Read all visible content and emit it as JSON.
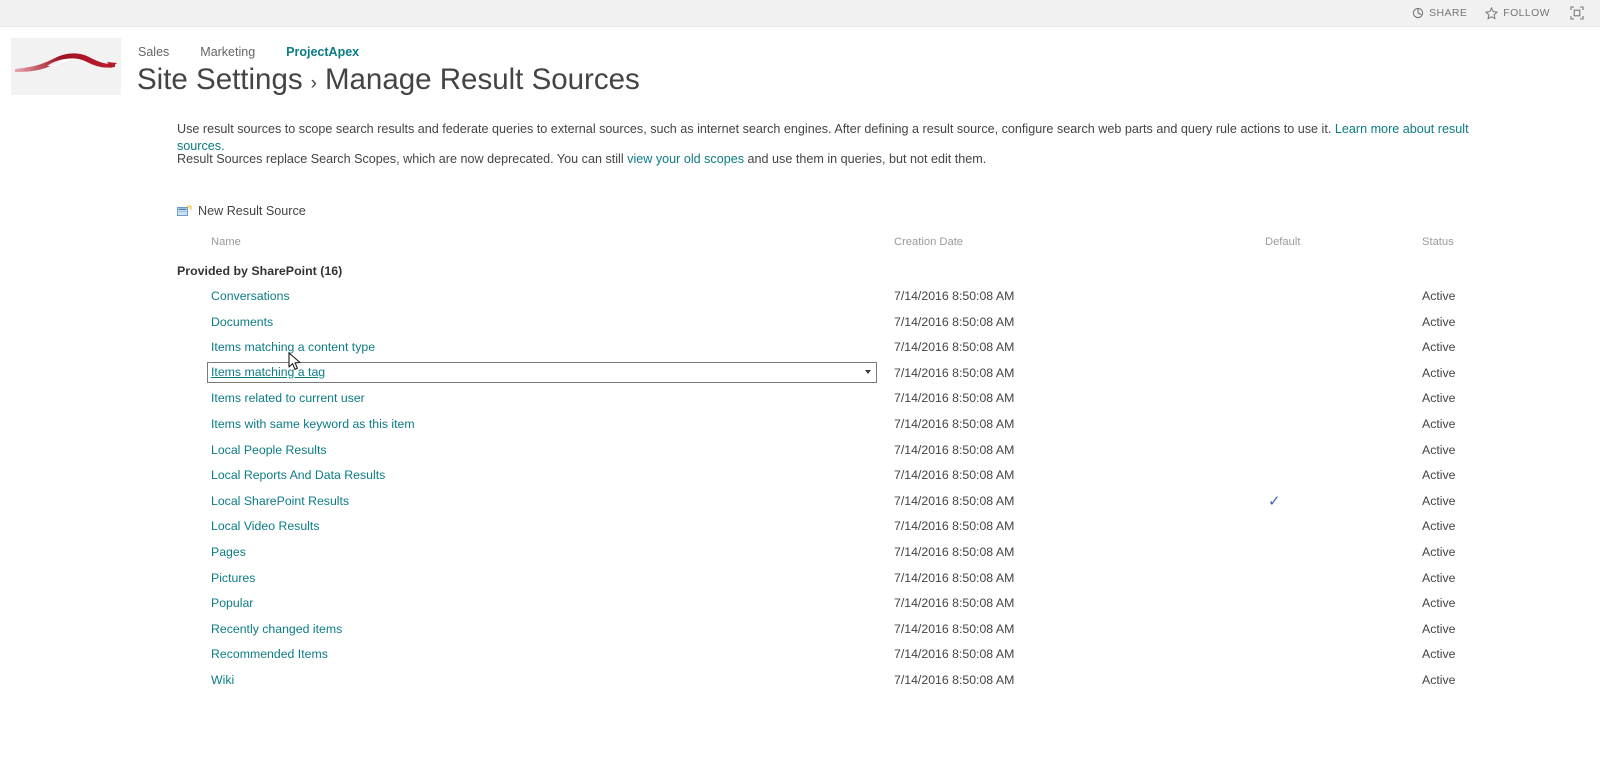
{
  "suitebar": {
    "share_label": "SHARE",
    "follow_label": "FOLLOW",
    "share_icon": "share-icon",
    "follow_icon": "star-icon",
    "focus_icon": "focus-on-content-icon"
  },
  "header": {
    "logo_alt": "car-logo",
    "nav": [
      {
        "label": "Sales",
        "current": false
      },
      {
        "label": "Marketing",
        "current": false
      },
      {
        "label": "ProjectApex",
        "current": true
      }
    ],
    "site_title": "Site Settings",
    "separator": "›",
    "page_title": "Manage Result Sources"
  },
  "description": {
    "line1_part1": "Use result sources to scope search results and federate queries to external sources, such as internet search engines. After defining a result source, configure search web parts and query rule actions to use it. ",
    "line1_link": "Learn more about result sources.",
    "line2_part1": "Result Sources replace Search Scopes, which are now deprecated. You can still ",
    "line2_link": "view your old scopes",
    "line2_part2": " and use them in queries, but not edit them."
  },
  "toolbar": {
    "new_result_source_label": "New Result Source",
    "new_result_source_icon": "new-item-icon"
  },
  "table": {
    "columns": {
      "name": "Name",
      "creation_date": "Creation Date",
      "default": "Default",
      "status": "Status"
    },
    "group_header": "Provided by SharePoint (16)",
    "rows": [
      {
        "name": "Conversations",
        "date": "7/14/2016 8:50:08 AM",
        "default": "",
        "status": "Active",
        "selected": false
      },
      {
        "name": "Documents",
        "date": "7/14/2016 8:50:08 AM",
        "default": "",
        "status": "Active",
        "selected": false
      },
      {
        "name": "Items matching a content type",
        "date": "7/14/2016 8:50:08 AM",
        "default": "",
        "status": "Active",
        "selected": false
      },
      {
        "name": "Items matching a tag",
        "date": "7/14/2016 8:50:08 AM",
        "default": "",
        "status": "Active",
        "selected": true
      },
      {
        "name": "Items related to current user",
        "date": "7/14/2016 8:50:08 AM",
        "default": "",
        "status": "Active",
        "selected": false
      },
      {
        "name": "Items with same keyword as this item",
        "date": "7/14/2016 8:50:08 AM",
        "default": "",
        "status": "Active",
        "selected": false
      },
      {
        "name": "Local People Results",
        "date": "7/14/2016 8:50:08 AM",
        "default": "",
        "status": "Active",
        "selected": false
      },
      {
        "name": "Local Reports And Data Results",
        "date": "7/14/2016 8:50:08 AM",
        "default": "",
        "status": "Active",
        "selected": false
      },
      {
        "name": "Local SharePoint Results",
        "date": "7/14/2016 8:50:08 AM",
        "default": "✓",
        "status": "Active",
        "selected": false
      },
      {
        "name": "Local Video Results",
        "date": "7/14/2016 8:50:08 AM",
        "default": "",
        "status": "Active",
        "selected": false
      },
      {
        "name": "Pages",
        "date": "7/14/2016 8:50:08 AM",
        "default": "",
        "status": "Active",
        "selected": false
      },
      {
        "name": "Pictures",
        "date": "7/14/2016 8:50:08 AM",
        "default": "",
        "status": "Active",
        "selected": false
      },
      {
        "name": "Popular",
        "date": "7/14/2016 8:50:08 AM",
        "default": "",
        "status": "Active",
        "selected": false
      },
      {
        "name": "Recently changed items",
        "date": "7/14/2016 8:50:08 AM",
        "default": "",
        "status": "Active",
        "selected": false
      },
      {
        "name": "Recommended Items",
        "date": "7/14/2016 8:50:08 AM",
        "default": "",
        "status": "Active",
        "selected": false
      },
      {
        "name": "Wiki",
        "date": "7/14/2016 8:50:08 AM",
        "default": "",
        "status": "Active",
        "selected": false
      }
    ]
  },
  "colors": {
    "accent_teal": "#0b7c84",
    "text_dark": "#444444",
    "suitebar_bg": "#f1f1f1",
    "check_blue": "#4a5fc0",
    "logo_red": "#b5182b"
  }
}
